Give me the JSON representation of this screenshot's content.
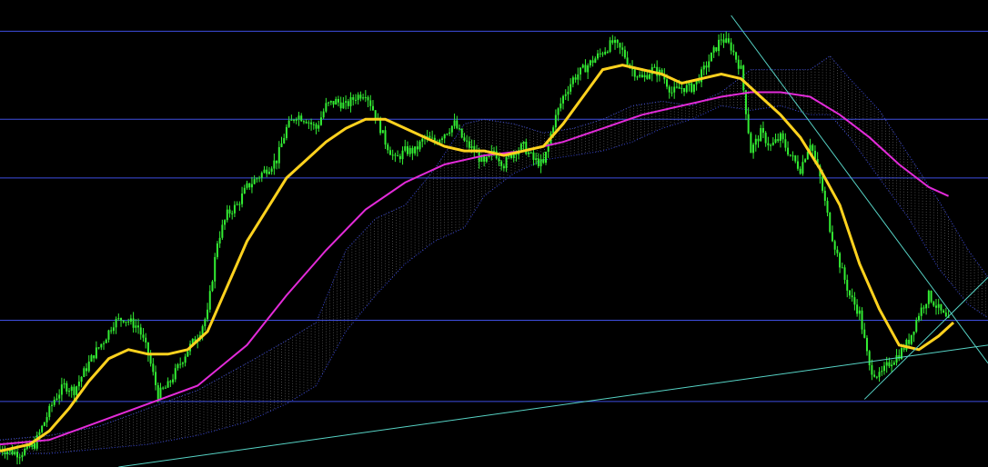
{
  "window": {
    "symbol_caption": ""
  },
  "colors": {
    "background": "#000000",
    "bull_bar": "#33ee33",
    "bear_bar": "#33ee33",
    "fast_ma": "#ffd21e",
    "slow_ma": "#e32bd9",
    "cloud_fill": "#8c8c8c",
    "cloud_edge": "#3a48d8",
    "horizontal_level": "#3e4ee0",
    "trendline": "#57d4c6"
  },
  "chart_data": {
    "type": "candlestick",
    "title": "",
    "xlabel": "",
    "ylabel": "",
    "grid": false,
    "x_range": [
      0,
      200
    ],
    "ylim": [
      0,
      100
    ],
    "horizontal_levels": [
      96.5,
      77,
      64,
      32.5,
      14.5
    ],
    "price_path": [
      [
        0,
        4
      ],
      [
        4,
        3
      ],
      [
        7,
        5
      ],
      [
        9,
        10
      ],
      [
        11,
        15
      ],
      [
        13,
        18
      ],
      [
        15,
        17
      ],
      [
        17,
        21
      ],
      [
        19,
        25
      ],
      [
        21,
        28
      ],
      [
        23,
        32
      ],
      [
        25,
        33
      ],
      [
        28,
        31
      ],
      [
        30,
        25
      ],
      [
        32,
        16
      ],
      [
        34,
        18
      ],
      [
        36,
        22
      ],
      [
        38,
        26
      ],
      [
        40,
        29
      ],
      [
        42,
        34
      ],
      [
        44,
        50
      ],
      [
        46,
        56
      ],
      [
        48,
        58
      ],
      [
        50,
        62
      ],
      [
        52,
        64
      ],
      [
        54,
        66
      ],
      [
        56,
        68
      ],
      [
        58,
        75
      ],
      [
        60,
        78
      ],
      [
        62,
        77
      ],
      [
        64,
        75
      ],
      [
        66,
        80
      ],
      [
        68,
        81
      ],
      [
        70,
        80
      ],
      [
        72,
        82
      ],
      [
        74,
        83
      ],
      [
        76,
        78
      ],
      [
        78,
        72
      ],
      [
        80,
        68
      ],
      [
        82,
        70
      ],
      [
        84,
        70
      ],
      [
        86,
        73
      ],
      [
        88,
        72
      ],
      [
        90,
        74
      ],
      [
        92,
        76
      ],
      [
        94,
        72
      ],
      [
        96,
        70
      ],
      [
        98,
        67
      ],
      [
        100,
        70
      ],
      [
        102,
        67
      ],
      [
        104,
        70
      ],
      [
        106,
        71
      ],
      [
        108,
        68
      ],
      [
        110,
        67
      ],
      [
        112,
        76
      ],
      [
        114,
        82
      ],
      [
        116,
        86
      ],
      [
        118,
        88
      ],
      [
        120,
        90
      ],
      [
        122,
        92
      ],
      [
        124,
        94
      ],
      [
        126,
        92
      ],
      [
        128,
        88
      ],
      [
        130,
        86
      ],
      [
        132,
        88
      ],
      [
        134,
        87
      ],
      [
        136,
        83
      ],
      [
        138,
        84
      ],
      [
        140,
        84
      ],
      [
        142,
        87
      ],
      [
        144,
        91
      ],
      [
        146,
        95
      ],
      [
        148,
        93
      ],
      [
        150,
        88
      ],
      [
        152,
        70
      ],
      [
        154,
        74
      ],
      [
        156,
        71
      ],
      [
        158,
        73
      ],
      [
        160,
        69
      ],
      [
        162,
        66
      ],
      [
        164,
        72
      ],
      [
        166,
        64
      ],
      [
        168,
        53
      ],
      [
        170,
        45
      ],
      [
        172,
        38
      ],
      [
        174,
        34
      ],
      [
        176,
        22
      ],
      [
        178,
        20
      ],
      [
        180,
        23
      ],
      [
        182,
        25
      ],
      [
        184,
        28
      ],
      [
        186,
        34
      ],
      [
        188,
        38
      ],
      [
        190,
        35
      ],
      [
        192,
        32
      ]
    ],
    "series": [
      {
        "values": [
          [
            0,
            3.5
          ],
          [
            6,
            5
          ],
          [
            10,
            8
          ],
          [
            14,
            13
          ],
          [
            18,
            19
          ],
          [
            22,
            24
          ],
          [
            26,
            26
          ],
          [
            30,
            25
          ],
          [
            34,
            25
          ],
          [
            38,
            26
          ],
          [
            42,
            30
          ],
          [
            46,
            40
          ],
          [
            50,
            50
          ],
          [
            54,
            57
          ],
          [
            58,
            64
          ],
          [
            62,
            68
          ],
          [
            66,
            72
          ],
          [
            70,
            75
          ],
          [
            74,
            77
          ],
          [
            78,
            77
          ],
          [
            82,
            75
          ],
          [
            86,
            73
          ],
          [
            90,
            71
          ],
          [
            94,
            70
          ],
          [
            98,
            70
          ],
          [
            102,
            69
          ],
          [
            106,
            70
          ],
          [
            110,
            71
          ],
          [
            114,
            76
          ],
          [
            118,
            82
          ],
          [
            122,
            88
          ],
          [
            126,
            89
          ],
          [
            130,
            88
          ],
          [
            134,
            87
          ],
          [
            138,
            85
          ],
          [
            142,
            86
          ],
          [
            146,
            87
          ],
          [
            150,
            86
          ],
          [
            154,
            82
          ],
          [
            158,
            78
          ],
          [
            162,
            73
          ],
          [
            166,
            66
          ],
          [
            170,
            58
          ],
          [
            174,
            45
          ],
          [
            178,
            35
          ],
          [
            182,
            27
          ],
          [
            186,
            26
          ],
          [
            190,
            29
          ],
          [
            193,
            32
          ]
        ]
      },
      {
        "values": [
          [
            0,
            5
          ],
          [
            10,
            6
          ],
          [
            20,
            10
          ],
          [
            30,
            14
          ],
          [
            40,
            18
          ],
          [
            50,
            27
          ],
          [
            58,
            38
          ],
          [
            66,
            48
          ],
          [
            74,
            57
          ],
          [
            82,
            63
          ],
          [
            90,
            67
          ],
          [
            98,
            69
          ],
          [
            106,
            70
          ],
          [
            114,
            72
          ],
          [
            122,
            75
          ],
          [
            130,
            78
          ],
          [
            138,
            80
          ],
          [
            146,
            82
          ],
          [
            152,
            83
          ],
          [
            158,
            83
          ],
          [
            164,
            82
          ],
          [
            170,
            78
          ],
          [
            176,
            73
          ],
          [
            182,
            67
          ],
          [
            188,
            62
          ],
          [
            192,
            60
          ]
        ]
      }
    ],
    "cloud": {
      "upper": [
        [
          0,
          6
        ],
        [
          10,
          7
        ],
        [
          20,
          9
        ],
        [
          30,
          13
        ],
        [
          40,
          17
        ],
        [
          50,
          23
        ],
        [
          58,
          28
        ],
        [
          64,
          32
        ],
        [
          70,
          48
        ],
        [
          76,
          55
        ],
        [
          82,
          58
        ],
        [
          88,
          66
        ],
        [
          94,
          76
        ],
        [
          98,
          77
        ],
        [
          104,
          76
        ],
        [
          110,
          74
        ],
        [
          116,
          75
        ],
        [
          122,
          77
        ],
        [
          128,
          80
        ],
        [
          134,
          81
        ],
        [
          140,
          80
        ],
        [
          146,
          83
        ],
        [
          152,
          88
        ],
        [
          158,
          88
        ],
        [
          164,
          88
        ],
        [
          168,
          91
        ],
        [
          172,
          86
        ],
        [
          178,
          79
        ],
        [
          184,
          69
        ],
        [
          190,
          59
        ],
        [
          196,
          48
        ],
        [
          200,
          42
        ]
      ],
      "lower": [
        [
          0,
          3
        ],
        [
          10,
          3
        ],
        [
          20,
          4
        ],
        [
          30,
          5
        ],
        [
          40,
          7
        ],
        [
          50,
          10
        ],
        [
          58,
          14
        ],
        [
          64,
          18
        ],
        [
          70,
          30
        ],
        [
          76,
          38
        ],
        [
          82,
          45
        ],
        [
          88,
          50
        ],
        [
          94,
          53
        ],
        [
          98,
          60
        ],
        [
          104,
          65
        ],
        [
          110,
          68
        ],
        [
          116,
          69
        ],
        [
          122,
          70
        ],
        [
          128,
          72
        ],
        [
          134,
          75
        ],
        [
          140,
          77
        ],
        [
          146,
          80
        ],
        [
          152,
          79
        ],
        [
          158,
          80
        ],
        [
          164,
          78
        ],
        [
          168,
          78
        ],
        [
          172,
          73
        ],
        [
          178,
          64
        ],
        [
          184,
          55
        ],
        [
          190,
          44
        ],
        [
          196,
          36
        ],
        [
          200,
          33
        ]
      ]
    },
    "trendlines": [
      {
        "x": [
          24,
          200
        ],
        "y": [
          0,
          27
        ]
      },
      {
        "x": [
          148,
          200
        ],
        "y": [
          100,
          23
        ]
      },
      {
        "x": [
          175,
          200
        ],
        "y": [
          15,
          42
        ]
      }
    ]
  }
}
